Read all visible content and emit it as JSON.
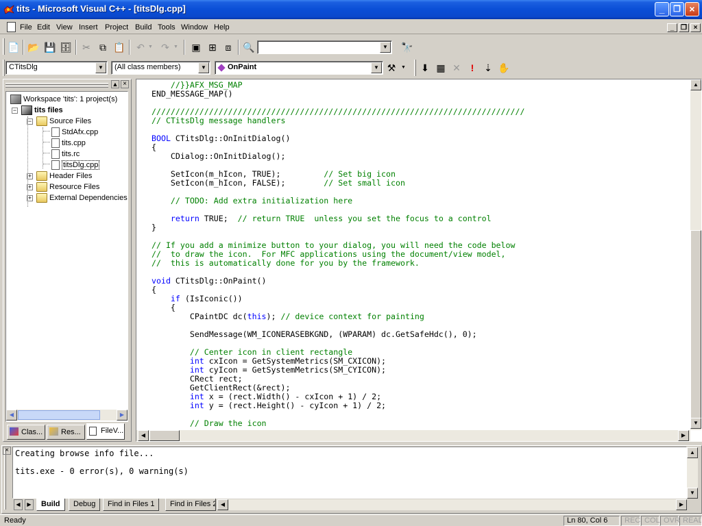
{
  "window": {
    "title": "tits - Microsoft Visual C++ - [titsDlg.cpp]",
    "minimize_label": "_",
    "maximize_label": "❐",
    "close_label": "×"
  },
  "menu": {
    "items": [
      "File",
      "Edit",
      "View",
      "Insert",
      "Project",
      "Build",
      "Tools",
      "Window",
      "Help"
    ]
  },
  "toolbar": {
    "find_combo_value": "",
    "class_combo": "CTitsDlg",
    "filter_combo": "(All class members)",
    "member_combo": "OnPaint"
  },
  "workspace": {
    "tree": [
      {
        "label": "Workspace 'tits': 1 project(s)",
        "level": 0,
        "icon": "workspace-icon"
      },
      {
        "label": "tits files",
        "level": 1,
        "icon": "project-icon",
        "bold": true
      },
      {
        "label": "Source Files",
        "level": 2,
        "icon": "folder-open-icon"
      },
      {
        "label": "StdAfx.cpp",
        "level": 3,
        "icon": "cpp-file-icon"
      },
      {
        "label": "tits.cpp",
        "level": 3,
        "icon": "cpp-file-icon"
      },
      {
        "label": "tits.rc",
        "level": 3,
        "icon": "rc-file-icon"
      },
      {
        "label": "titsDlg.cpp",
        "level": 3,
        "icon": "cpp-file-icon",
        "selected": true
      },
      {
        "label": "Header Files",
        "level": 2,
        "icon": "folder-icon"
      },
      {
        "label": "Resource Files",
        "level": 2,
        "icon": "folder-icon"
      },
      {
        "label": "External Dependencies",
        "level": 2,
        "icon": "folder-icon"
      }
    ],
    "tabs": [
      "Clas...",
      "Res...",
      "FileV..."
    ]
  },
  "editor": {
    "lines": [
      "    //}}AFX_MSG_MAP",
      "END_MESSAGE_MAP()",
      "",
      "//////////////////////////////////////////////////////////////////////////////",
      "// CTitsDlg message handlers",
      "",
      "BOOL CTitsDlg::OnInitDialog()",
      "{",
      "    CDialog::OnInitDialog();",
      "",
      "    SetIcon(m_hIcon, TRUE);         // Set big icon",
      "    SetIcon(m_hIcon, FALSE);        // Set small icon",
      "",
      "    // TODO: Add extra initialization here",
      "",
      "    return TRUE;  // return TRUE  unless you set the focus to a control",
      "}",
      "",
      "// If you add a minimize button to your dialog, you will need the code below",
      "//  to draw the icon.  For MFC applications using the document/view model,",
      "//  this is automatically done for you by the framework.",
      "",
      "void CTitsDlg::OnPaint()",
      "{",
      "    if (IsIconic())",
      "    {",
      "        CPaintDC dc(this); // device context for painting",
      "",
      "        SendMessage(WM_ICONERASEBKGND, (WPARAM) dc.GetSafeHdc(), 0);",
      "",
      "        // Center icon in client rectangle",
      "        int cxIcon = GetSystemMetrics(SM_CXICON);",
      "        int cyIcon = GetSystemMetrics(SM_CYICON);",
      "        CRect rect;",
      "        GetClientRect(&rect);",
      "        int x = (rect.Width() - cxIcon + 1) / 2;",
      "        int y = (rect.Height() - cyIcon + 1) / 2;",
      "",
      "        // Draw the icon"
    ]
  },
  "output": {
    "lines": [
      "Creating browse info file...",
      "",
      "tits.exe - 0 error(s), 0 warning(s)"
    ],
    "tabs": [
      "Build",
      "Debug",
      "Find in Files 1",
      "Find in Files 2"
    ]
  },
  "status": {
    "message": "Ready",
    "position": "Ln 80, Col 6",
    "indicators": [
      "REC",
      "COL",
      "OVR",
      "READ"
    ]
  }
}
